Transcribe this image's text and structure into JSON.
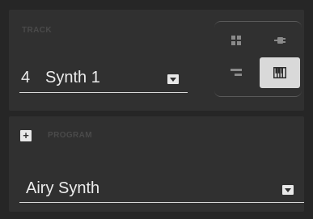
{
  "track": {
    "section_label": "TRACK",
    "number": "4",
    "name": "Synth 1"
  },
  "track_type": {
    "options": [
      "drum-program-icon",
      "plugin-icon",
      "clip-program-icon",
      "keygroup-icon"
    ],
    "selected": "keygroup-icon"
  },
  "program": {
    "add_label": "+",
    "section_label": "PROGRAM",
    "name": "Airy Synth"
  },
  "colors": {
    "background": "#262626",
    "panel": "#303030",
    "text": "#ececec",
    "selected_button": "#d9d9d9"
  }
}
